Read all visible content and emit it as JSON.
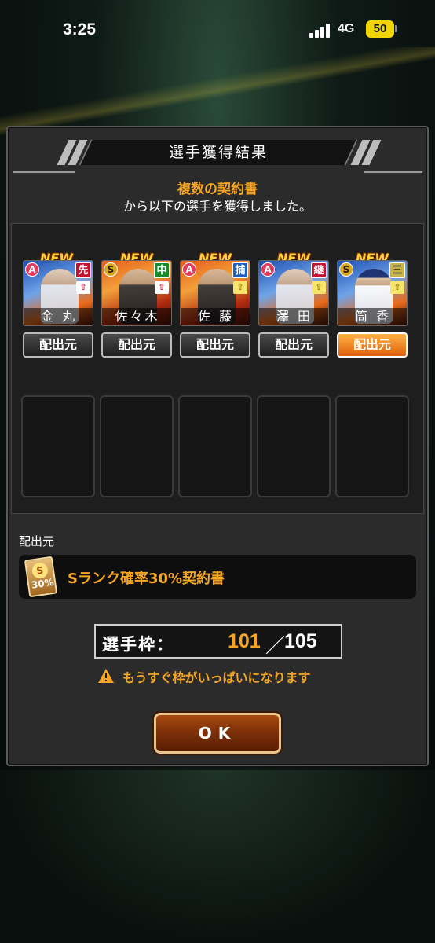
{
  "status": {
    "time": "3:25",
    "network": "4G",
    "battery": "50"
  },
  "dialog": {
    "title": "選手獲得結果",
    "message_highlight": "複数の契約書",
    "message_rest": "から以下の選手を獲得しました。"
  },
  "players": [
    {
      "name": "金 丸",
      "rank": "A",
      "position": "先",
      "new_label": "NEW",
      "source_button": "配出元",
      "active": false
    },
    {
      "name": "佐々木",
      "rank": "S",
      "position": "中",
      "new_label": "NEW",
      "source_button": "配出元",
      "active": false
    },
    {
      "name": "佐 藤",
      "rank": "A",
      "position": "捕",
      "new_label": "NEW",
      "source_button": "配出元",
      "active": false
    },
    {
      "name": "澤 田",
      "rank": "A",
      "position": "継",
      "new_label": "NEW",
      "source_button": "配出元",
      "active": false
    },
    {
      "name": "筒 香",
      "rank": "S",
      "position": "三",
      "new_label": "NEW",
      "source_button": "配出元",
      "active": true
    }
  ],
  "source": {
    "title": "配出元",
    "item_text": "Sランク確率30%契約書",
    "icon_seal": "S",
    "icon_pct": "30%"
  },
  "roster": {
    "label": "選手枠：",
    "current": "101",
    "separator": "／",
    "max": "105",
    "warning": "もうすぐ枠がいっぱいになります"
  },
  "ok_label": "OK",
  "colors": {
    "accent": "#f6a623",
    "active_button": "#e0600a",
    "panel": "#2b2b2b"
  }
}
